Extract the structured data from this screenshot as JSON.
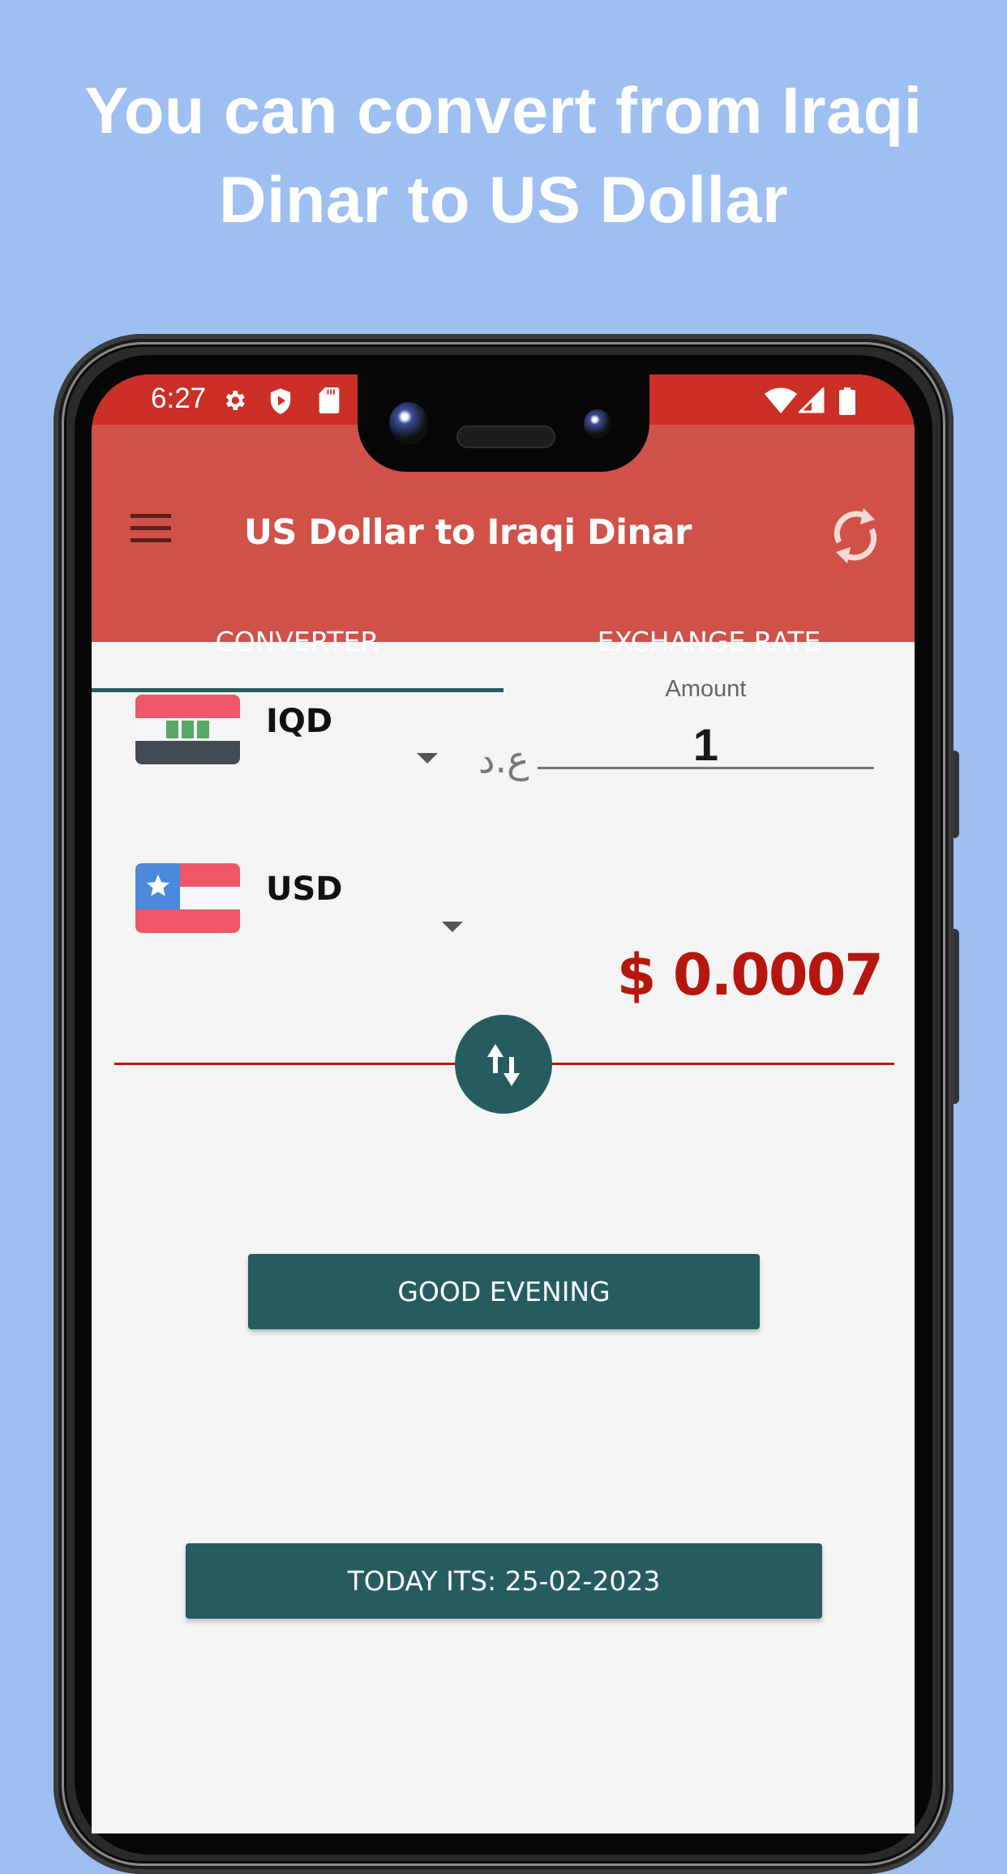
{
  "promo": {
    "headline_line1": "You can convert from Iraqi",
    "headline_line2": "Dinar to US Dollar"
  },
  "status_bar": {
    "time": "6:27",
    "left_icons": [
      "settings-icon",
      "shield-play-icon",
      "sd-card-icon"
    ],
    "right_icons": [
      "wifi-icon",
      "signal-icon",
      "battery-icon"
    ]
  },
  "app_bar": {
    "title": "US Dollar to Iraqi Dinar",
    "menu_icon": "hamburger-menu-icon",
    "action_icon": "refresh-icon"
  },
  "tabs": [
    {
      "label": "CONVERTER",
      "selected": true
    },
    {
      "label": "EXCHANGE RATE",
      "selected": false
    }
  ],
  "converter": {
    "from": {
      "code": "IQD",
      "flag": "iraq-flag",
      "symbol": "ع.د"
    },
    "to": {
      "code": "USD",
      "flag": "us-flag"
    },
    "amount_label": "Amount",
    "amount_value": "1",
    "result": "$ 0.0007",
    "swap_icon": "swap-vertical-icon"
  },
  "buttons": {
    "greeting": "GOOD EVENING",
    "today": "TODAY ITS: 25-02-2023"
  },
  "colors": {
    "background": "#9dbff2",
    "status_bar": "#cc2f26",
    "app_bar": "#cf5148",
    "accent": "#265c60",
    "result_text": "#b5170f"
  }
}
